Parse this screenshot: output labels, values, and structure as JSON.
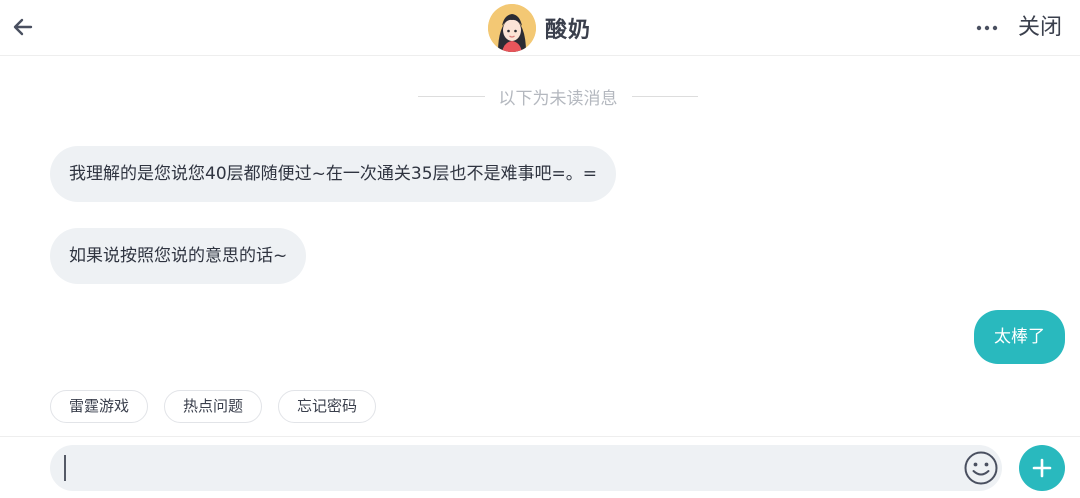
{
  "header": {
    "title": "酸奶",
    "close_label": "关闭"
  },
  "divider": {
    "text": "以下为未读消息"
  },
  "messages": [
    {
      "from": "agent",
      "text": "我理解的是您说您40层都随便过~在一次通关35层也不是难事吧=。="
    },
    {
      "from": "agent",
      "text": "如果说按照您说的意思的话~"
    },
    {
      "from": "user",
      "text": "太棒了"
    }
  ],
  "quick_replies": [
    "雷霆游戏",
    "热点问题",
    "忘记密码"
  ],
  "input": {
    "value": "",
    "placeholder": ""
  },
  "colors": {
    "accent": "#29b9be",
    "incoming_bubble": "#eef1f4",
    "text": "#333a45",
    "muted": "#b4b8bf"
  },
  "icons": {
    "back": "arrow-left-icon",
    "more": "more-dots-icon",
    "emoji": "smiley-icon",
    "add": "plus-icon"
  }
}
